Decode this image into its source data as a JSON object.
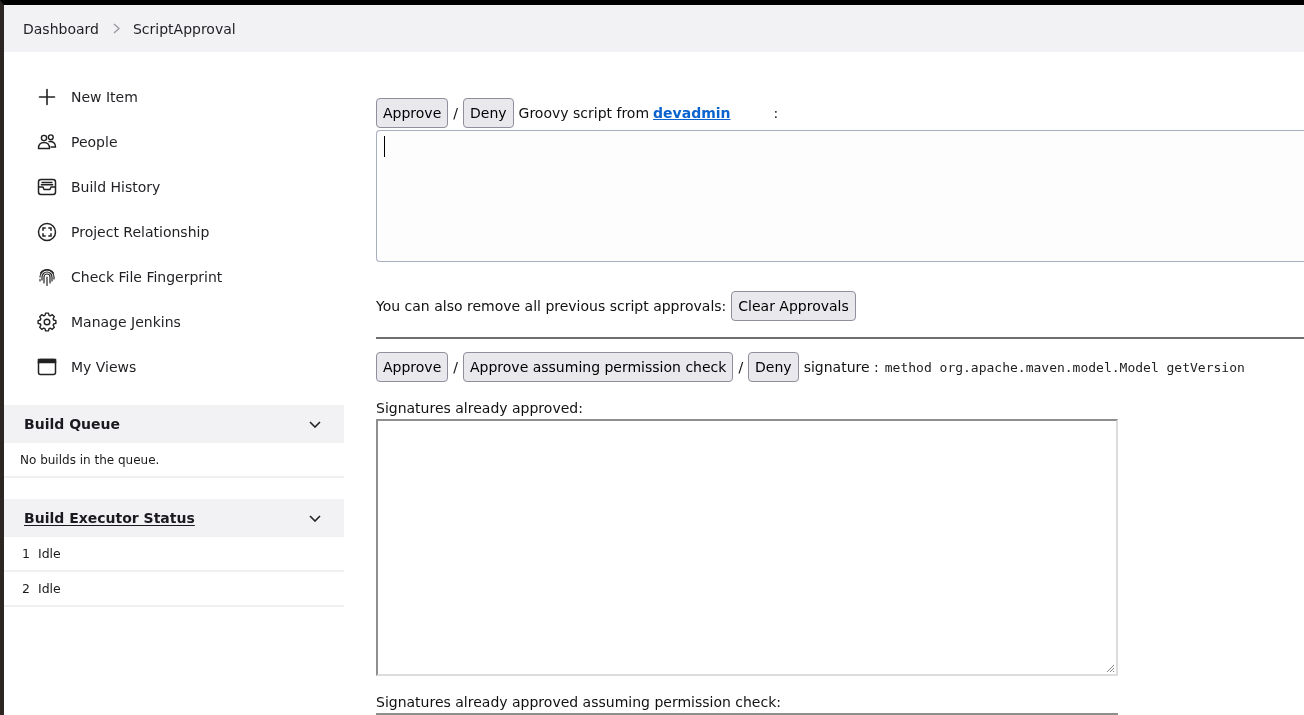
{
  "breadcrumb": [
    {
      "label": "Dashboard"
    },
    {
      "label": "ScriptApproval"
    }
  ],
  "side_nav": [
    {
      "label": "New Item"
    },
    {
      "label": "People"
    },
    {
      "label": "Build History"
    },
    {
      "label": "Project Relationship"
    },
    {
      "label": "Check File Fingerprint"
    },
    {
      "label": "Manage Jenkins"
    },
    {
      "label": "My Views"
    }
  ],
  "build_queue": {
    "title": "Build Queue",
    "expanded": true,
    "message": "No builds in the queue."
  },
  "executor_status": {
    "title": "Build Executor Status",
    "expanded": true,
    "executors": [
      {
        "number": "1",
        "status": "Idle"
      },
      {
        "number": "2",
        "status": "Idle"
      }
    ]
  },
  "pending_script": {
    "actions": [
      {
        "kind": "button",
        "label": "Approve"
      },
      {
        "kind": "separator",
        "label": "/"
      },
      {
        "kind": "button",
        "label": "Deny"
      }
    ],
    "description": "Groovy script from",
    "user": "devadmin",
    "suffix": ":",
    "script": {
      "focused": true
    }
  },
  "clear_approvals": {
    "text": "You can also remove all previous script approvals:",
    "button": "Clear Approvals"
  },
  "pending_signature": {
    "actions": [
      {
        "kind": "button",
        "label": "Approve"
      },
      {
        "kind": "separator",
        "label": "/"
      },
      {
        "kind": "button",
        "label": "Approve assuming permission check"
      },
      {
        "kind": "separator",
        "label": "/"
      },
      {
        "kind": "button",
        "label": "Deny"
      }
    ],
    "label": "signature :",
    "signature": "method org.apache.maven.model.Model getVersion"
  },
  "approved_signatures": {
    "label": "Signatures already approved:"
  },
  "approved_assuming_permission": {
    "label": "Signatures already approved assuming permission check:"
  }
}
